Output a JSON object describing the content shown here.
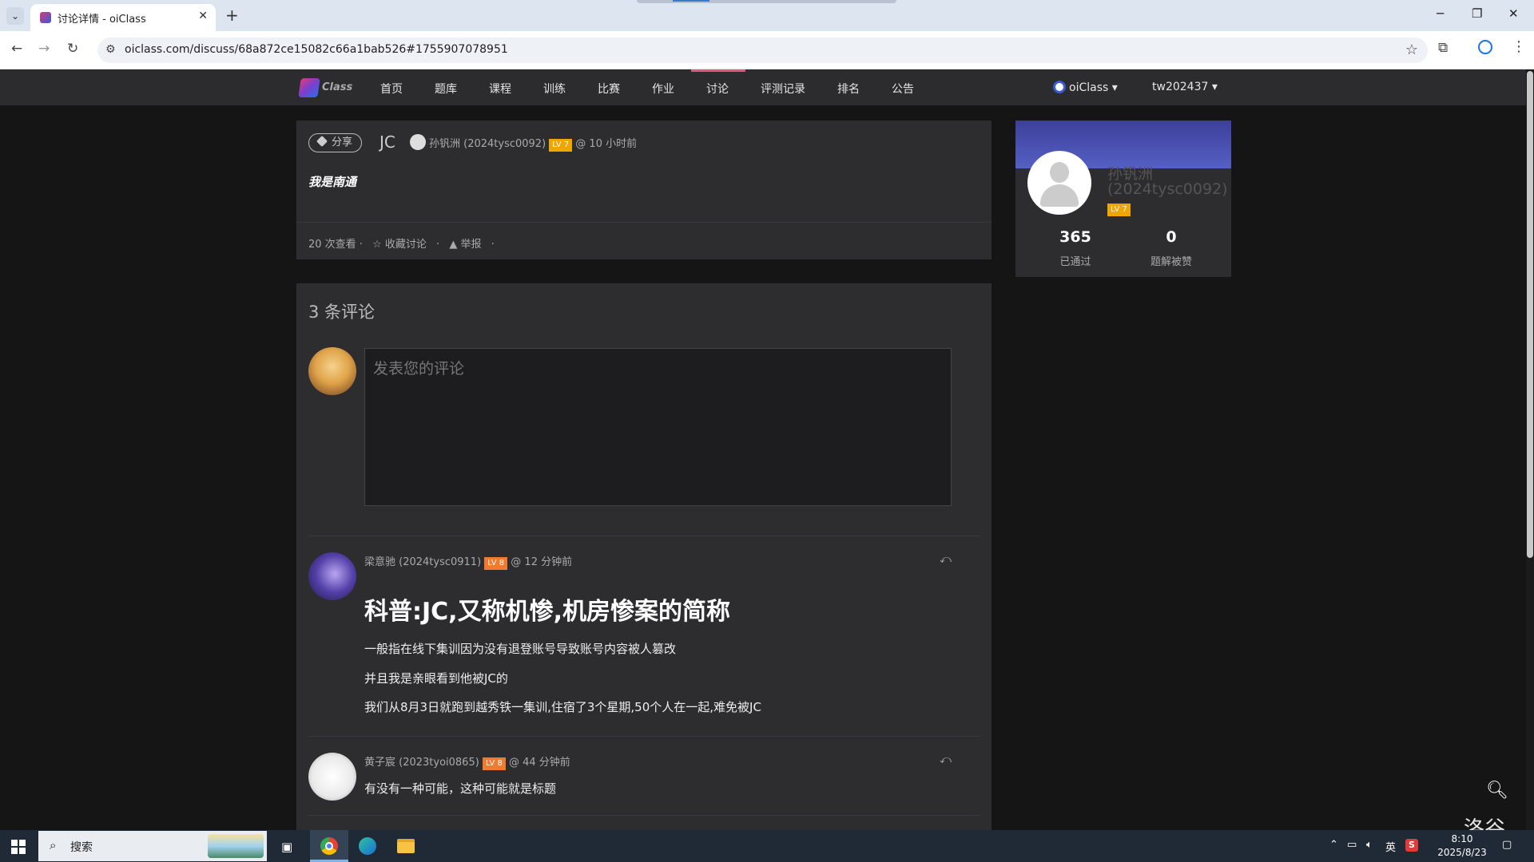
{
  "browser": {
    "tab_title": "讨论详情 - oiClass",
    "url": "oiclass.com/discuss/68a872ce15082c66a1bab526#1755907078951"
  },
  "nav": {
    "items": [
      {
        "label": "首页"
      },
      {
        "label": "题库"
      },
      {
        "label": "课程"
      },
      {
        "label": "训练"
      },
      {
        "label": "比赛"
      },
      {
        "label": "作业"
      },
      {
        "label": "讨论"
      },
      {
        "label": "评测记录"
      },
      {
        "label": "排名"
      },
      {
        "label": "公告"
      }
    ],
    "active": "讨论",
    "domain_menu": "oiClass",
    "user_menu": "tw202437",
    "accent_color": "#e0577f"
  },
  "topic": {
    "tag": "分享",
    "title": "JC",
    "author": "孙钒洲 (2024tysc0092)",
    "level": "LV 7",
    "time": "@ 10 小时前",
    "body": "我是南通",
    "views": "20 次查看 ·",
    "favorite": "☆ 收藏讨论",
    "dot1": "·",
    "report": "▲ 举报",
    "dot2": "·"
  },
  "comments": {
    "count_title": "3 条评论",
    "placeholder": "发表您的评论",
    "items": [
      {
        "author": "梁意驰 (2024tysc0911)",
        "level": "LV 8",
        "time": "@ 12 分钟前",
        "heading": "科普:JC,又称机惨,机房惨案的简称",
        "lines": [
          "一般指在线下集训因为没有退登账号导致账号内容被人篡改",
          "并且我是亲眼看到他被JC的",
          "我们从8月3日就跑到越秀铁一集训,住宿了3个星期,50个人在一起,难免被JC"
        ]
      },
      {
        "author": "黄子宸 (2023tyoi0865)",
        "level": "LV 8",
        "time": "@ 44 分钟前",
        "lines": [
          "有没有一种可能，这种可能就是标题"
        ]
      }
    ]
  },
  "profile": {
    "name": "孙钒洲 (2024tysc0092)",
    "level": "LV 7",
    "accepted": "365",
    "accepted_label": "已通过",
    "liked": "0",
    "liked_label": "题解被赞"
  },
  "watermark": "洛谷",
  "taskbar": {
    "search_label": "搜索",
    "ime": "英",
    "time": "8:10",
    "date": "2025/8/23"
  }
}
